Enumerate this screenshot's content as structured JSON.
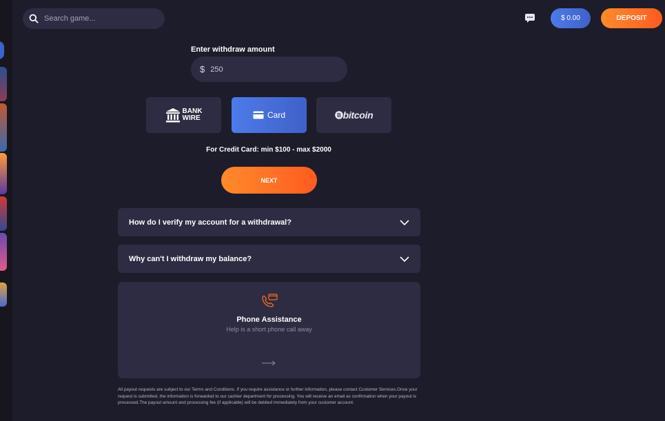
{
  "search": {
    "placeholder": "Search game..."
  },
  "header": {
    "balance": "$ 0.00",
    "deposit_label": "DEPOSIT"
  },
  "withdraw": {
    "label": "Enter withdraw amount",
    "currency_symbol": "$",
    "amount_value": "250",
    "methods": {
      "bank_line1": "BANK",
      "bank_line2": "WIRE",
      "card": "Card",
      "bitcoin": "bitcoin"
    },
    "limits": "For Credit Card: min $100 - max $2000",
    "next_label": "NEXT"
  },
  "faq": [
    {
      "question": "How do I verify my account for a withdrawal?"
    },
    {
      "question": "Why can't I withdraw my balance?"
    }
  ],
  "phone": {
    "title": "Phone Assistance",
    "subtitle": "Help is a short phone call away"
  },
  "disclaimer": "All payout requests are subject to our Terms and Conditions. If you require assistance or further information, please contact Customer Services.Once your request is submitted, the information is forwarded to our cashier department for processing. You will receive an email as confirmation when your payout is processed.The payout amount and processing fee (if applicable) will be debited immediately from your customer account.",
  "colors": {
    "background": "#1d1c2b",
    "panel": "#2d2c42",
    "accent_blue": "#4d7bea",
    "accent_orange": "#ff6a21"
  }
}
